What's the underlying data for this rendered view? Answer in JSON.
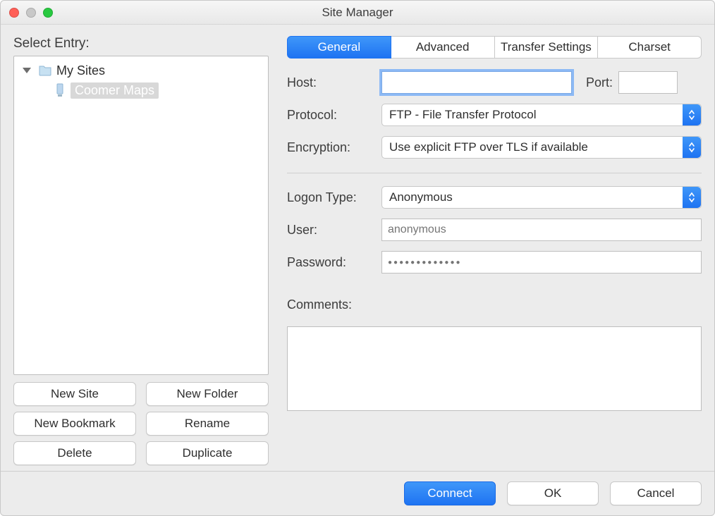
{
  "window": {
    "title": "Site Manager"
  },
  "sidebar": {
    "label": "Select Entry:",
    "root_label": "My Sites",
    "items": [
      {
        "label": "Coomer Maps",
        "selected": true
      }
    ]
  },
  "left_buttons": {
    "new_site": "New Site",
    "new_folder": "New Folder",
    "new_bookmark": "New Bookmark",
    "rename": "Rename",
    "delete": "Delete",
    "duplicate": "Duplicate"
  },
  "tabs": {
    "general": "General",
    "advanced": "Advanced",
    "transfer": "Transfer Settings",
    "charset": "Charset"
  },
  "form": {
    "host_label": "Host:",
    "host_value": "",
    "port_label": "Port:",
    "port_value": "",
    "protocol_label": "Protocol:",
    "protocol_value": "FTP - File Transfer Protocol",
    "encryption_label": "Encryption:",
    "encryption_value": "Use explicit FTP over TLS if available",
    "logon_label": "Logon Type:",
    "logon_value": "Anonymous",
    "user_label": "User:",
    "user_placeholder": "anonymous",
    "password_label": "Password:",
    "password_mask": "●●●●●●●●●●●●●",
    "comments_label": "Comments:"
  },
  "footer": {
    "connect": "Connect",
    "ok": "OK",
    "cancel": "Cancel"
  }
}
